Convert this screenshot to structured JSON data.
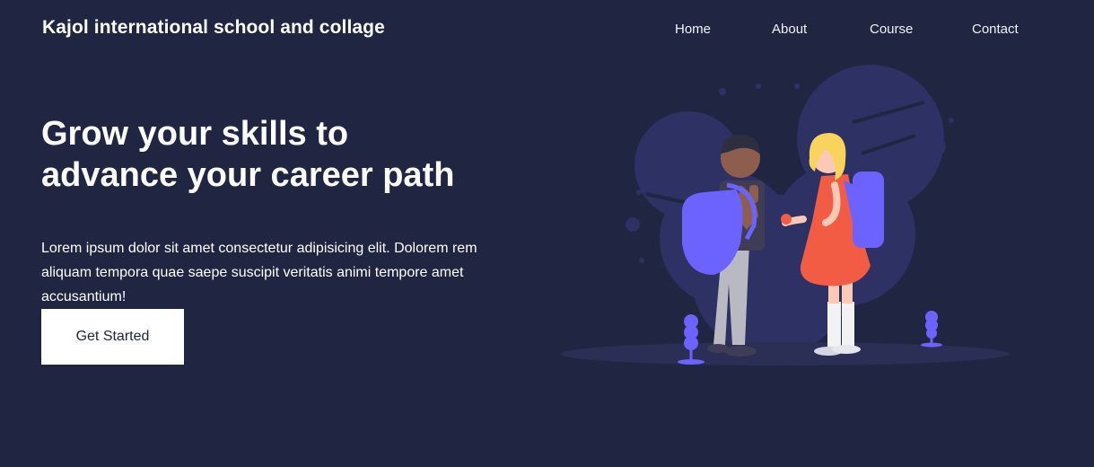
{
  "header": {
    "brand": "Kajol international school and collage",
    "nav": [
      {
        "label": "Home"
      },
      {
        "label": "About"
      },
      {
        "label": "Course"
      },
      {
        "label": "Contact"
      }
    ]
  },
  "hero": {
    "title": "Grow your skills to advance your career path",
    "description": "Lorem ipsum dolor sit amet consectetur adipisicing elit. Dolorem rem aliquam tempora quae saepe suscipit veritatis animi tempore amet accusantium!",
    "cta_label": "Get Started"
  },
  "illustration": {
    "icon": "students-with-backpacks-illustration",
    "colors": {
      "background": "#202642",
      "blob": "#2e3163",
      "accent_purple": "#6c63ff",
      "dress": "#f25c45",
      "hair_blonde": "#f9d45c",
      "ground": "#2b2f55"
    }
  }
}
